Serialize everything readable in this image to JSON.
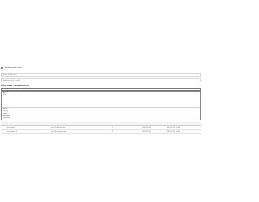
{
  "form": {
    "checkbox_label": "Enable/disable option",
    "input_1_placeholder": "Enter value here",
    "input_2_placeholder": "Additional field value",
    "section_label": "Select group / permission level",
    "select_value": "",
    "options": [
      "All",
      "Item",
      "",
      "",
      "",
      "",
      "",
      "",
      "Administrator",
      "Editor",
      "Viewer",
      "Contributor",
      "Guest",
      "Manager",
      "Operator"
    ],
    "selected_index": 8
  },
  "table": {
    "header": [
      "",
      "",
      "",
      "",
      "",
      ""
    ],
    "rows": [
      [
        "",
        "user_name",
        "user@example.com",
        "1",
        "2019-01-01",
        "2019-01-01 00:00"
      ],
      [
        "",
        "user_name_2",
        "user2@example.com",
        "1",
        "2019-01-01",
        "2019-01-01 00:00"
      ]
    ]
  }
}
